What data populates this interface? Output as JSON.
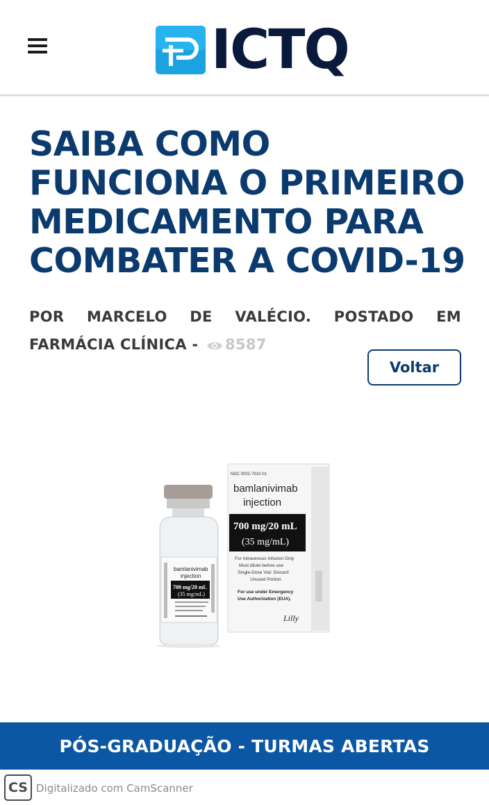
{
  "header": {
    "menu_icon": "hamburger-menu-icon",
    "logo_text": "ICTQ",
    "logo_icon": "pharmacy-logo-icon",
    "brand_color": "#0a1a3c",
    "logo_accent": "#1aa3e0"
  },
  "article": {
    "title": "SAIBA COMO FUNCIONA O PRIMEIRO MEDICAMENTO PARA COMBATER A COVID-19",
    "meta_prefix": "POR MARCELO DE VALÉCIO. POSTADO EM FARMÁCIA CLÍNICA -",
    "views_icon": "eye-icon",
    "views": "8587",
    "back_label": "Voltar",
    "title_color": "#0b3a6e"
  },
  "product_image": {
    "box_ndc": "NDC 0002-7910-01",
    "box_name_1": "bamlanivimab",
    "box_name_2": "injection",
    "box_dose": "700 mg/20 mL",
    "box_conc": "(35 mg/mL)",
    "box_info_1": "For Intravenous Infusion Only",
    "box_info_2": "Must dilute before use",
    "box_info_3": "Single-Dose Vial: Discard",
    "box_info_4": "Unused Portion",
    "box_eua_1": "For use under Emergency",
    "box_eua_2": "Use Authorization (EUA).",
    "box_brand": "Lilly",
    "vial_name_1": "bamlanivimab",
    "vial_name_2": "injection",
    "vial_dose": "700 mg/20 mL",
    "vial_conc": "(35 mg/mL)"
  },
  "banner": {
    "text": "PÓS-GRADUAÇÃO - TURMAS ABERTAS",
    "color": "#0b57a4"
  },
  "watermark": {
    "icon_text": "CS",
    "text": "Digitalizado com CamScanner"
  }
}
